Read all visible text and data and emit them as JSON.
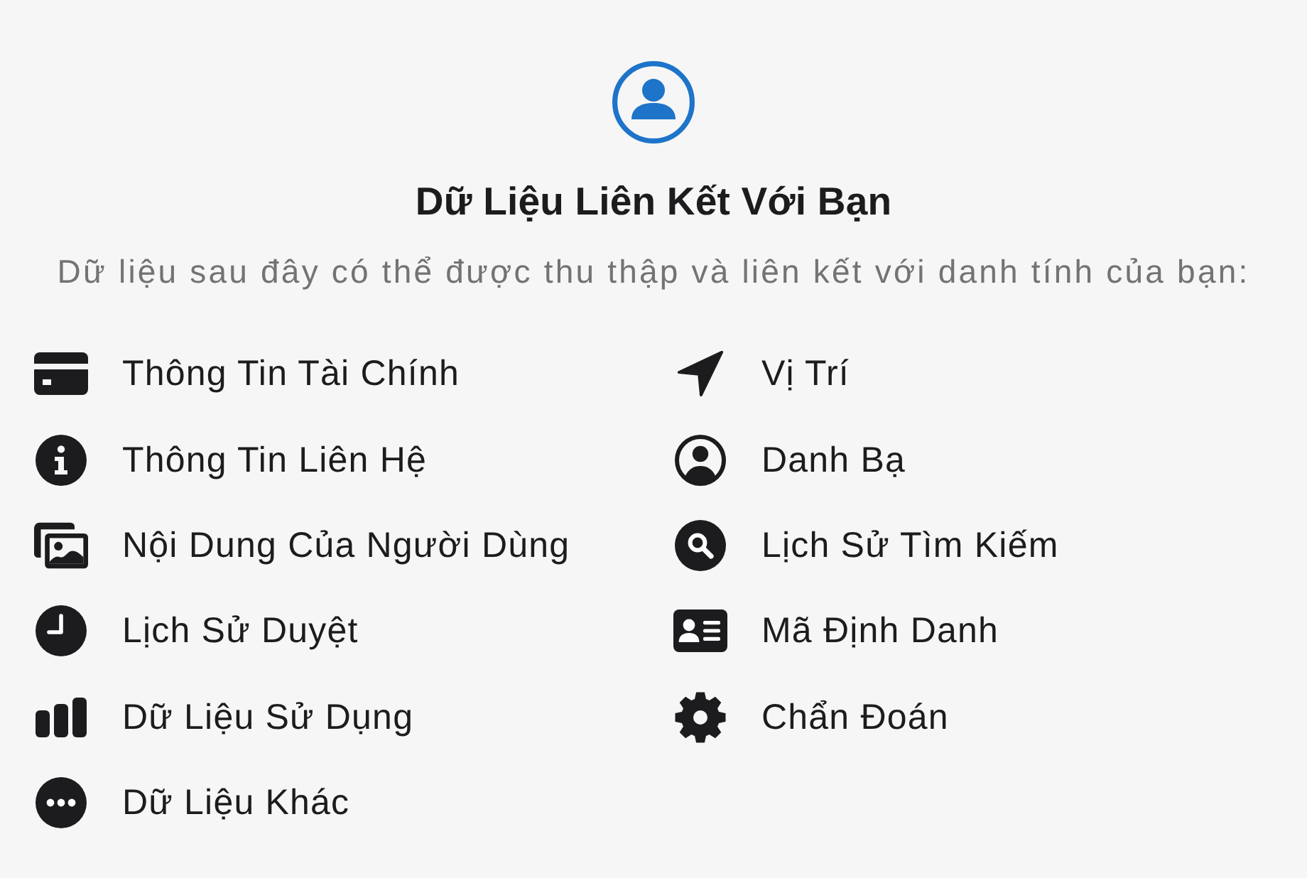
{
  "header": {
    "title": "Dữ Liệu Liên Kết Với Bạn",
    "subtitle": "Dữ liệu sau đây có thể được thu thập và liên kết với danh tính của bạn:"
  },
  "categories": [
    {
      "kind": "financial",
      "label": "Thông Tin Tài Chính"
    },
    {
      "kind": "location",
      "label": "Vị Trí"
    },
    {
      "kind": "contact_info",
      "label": "Thông Tin Liên Hệ"
    },
    {
      "kind": "contacts",
      "label": "Danh Bạ"
    },
    {
      "kind": "user_content",
      "label": "Nội Dung Của Người Dùng"
    },
    {
      "kind": "search_history",
      "label": "Lịch Sử Tìm Kiếm"
    },
    {
      "kind": "browsing_history",
      "label": "Lịch Sử Duyệt"
    },
    {
      "kind": "identifiers",
      "label": "Mã Định Danh"
    },
    {
      "kind": "usage_data",
      "label": "Dữ Liệu Sử Dụng"
    },
    {
      "kind": "diagnostics",
      "label": "Chẩn Đoán"
    },
    {
      "kind": "other_data",
      "label": "Dữ Liệu Khác"
    }
  ]
}
